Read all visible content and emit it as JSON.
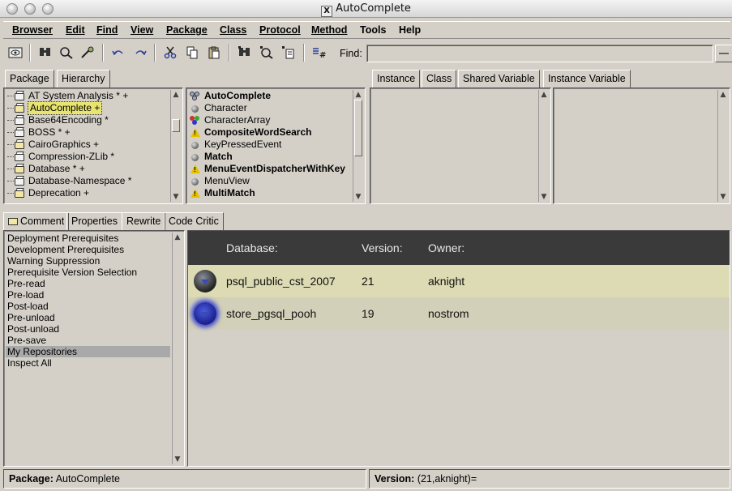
{
  "window": {
    "title": "AutoComplete",
    "x_badge": "X"
  },
  "menu": [
    "Browser",
    "Edit",
    "Find",
    "View",
    "Package",
    "Class",
    "Protocol",
    "Method",
    "Tools",
    "Help"
  ],
  "toolbar": {
    "buttons": [
      "browse-icon",
      "find-icon",
      "find-class-icon",
      "find-method-icon",
      "undo-icon",
      "redo-icon",
      "cut-icon",
      "copy-icon",
      "paste-icon",
      "senders-icon",
      "implementors-icon",
      "references-icon",
      "hash-icon"
    ],
    "find_label": "Find:",
    "find_value": ""
  },
  "package_tabs": [
    "Package",
    "Hierarchy"
  ],
  "packages": [
    {
      "label": "AT System Analysis * +",
      "kind": "package",
      "selected": false
    },
    {
      "label": "AutoComplete +",
      "kind": "bundle",
      "selected": true
    },
    {
      "label": "Base64Encoding *",
      "kind": "package",
      "selected": false
    },
    {
      "label": "BOSS * +",
      "kind": "package",
      "selected": false
    },
    {
      "label": "CairoGraphics +",
      "kind": "bundle",
      "selected": false
    },
    {
      "label": "Compression-ZLib *",
      "kind": "package",
      "selected": false
    },
    {
      "label": "Database * +",
      "kind": "bundle",
      "selected": false
    },
    {
      "label": "Database-Namespace *",
      "kind": "package",
      "selected": false
    },
    {
      "label": "Deprecation +",
      "kind": "bundle",
      "selected": false
    }
  ],
  "classes": [
    {
      "label": "AutoComplete",
      "icon": "namespace",
      "bold": true
    },
    {
      "label": "Character",
      "icon": "class",
      "bold": false
    },
    {
      "label": "CharacterArray",
      "icon": "multi",
      "bold": false
    },
    {
      "label": "CompositeWordSearch",
      "icon": "warning",
      "bold": true
    },
    {
      "label": "KeyPressedEvent",
      "icon": "class",
      "bold": false
    },
    {
      "label": "Match",
      "icon": "class",
      "bold": true
    },
    {
      "label": "MenuEventDispatcherWithKey",
      "icon": "warning",
      "bold": true
    },
    {
      "label": "MenuView",
      "icon": "class",
      "bold": false
    },
    {
      "label": "MultiMatch",
      "icon": "warning",
      "bold": true
    }
  ],
  "class_tabs": [
    "Instance",
    "Class",
    "Shared Variable",
    "Instance Variable"
  ],
  "lower_tabs": [
    "Comment",
    "Properties",
    "Rewrite",
    "Code Critic"
  ],
  "nav_items": [
    "Deployment Prerequisites",
    "Development Prerequisites",
    "Warning Suppression",
    "Prerequisite Version Selection",
    "Pre-read",
    "Pre-load",
    "Post-load",
    "Pre-unload",
    "Post-unload",
    "Pre-save",
    "My Repositories",
    "Inspect All"
  ],
  "nav_selected": "My Repositories",
  "repositories": {
    "headers": {
      "database": "Database:",
      "version": "Version:",
      "owner": "Owner:"
    },
    "rows": [
      {
        "database": "psql_public_cst_2007",
        "version": "21",
        "owner": "aknight",
        "active": false
      },
      {
        "database": "store_pgsql_pooh",
        "version": "19",
        "owner": "nostrom",
        "active": true
      }
    ]
  },
  "status": {
    "package_label": "Package:",
    "package_value": "AutoComplete",
    "version_label": "Version:",
    "version_value": "(21,aknight)="
  },
  "colors": {
    "chrome": "#d4d0c8",
    "repo_header": "#3a3a3a",
    "row_odd": "#dcdbb4",
    "row_even": "#d2d0b8",
    "selection": "#a9a9a9",
    "highlight": "#e8e470"
  }
}
